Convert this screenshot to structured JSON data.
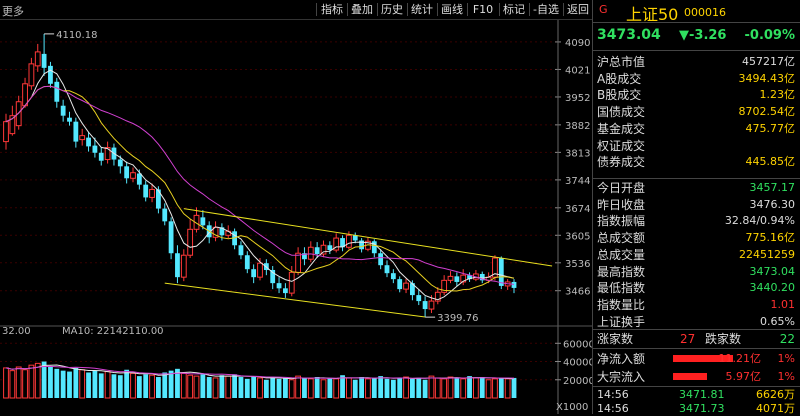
{
  "toolbar": {
    "left_label": "更多",
    "buttons": [
      "指标",
      "叠加",
      "历史",
      "统计",
      "画线",
      "F10",
      "标记",
      "-自选",
      "返回"
    ]
  },
  "chart_data": [
    {
      "type": "candlestick",
      "title": "",
      "y_ticks": [
        4090,
        4021,
        3952,
        3882,
        3813,
        3744,
        3674,
        3605,
        3536,
        3466
      ],
      "ylim": [
        3380,
        4140
      ],
      "annotations": [
        {
          "label": "4110.18",
          "value": 4110.18
        },
        {
          "label": "3399.76",
          "value": 3399.76
        }
      ],
      "candles": [
        {
          "o": 3840,
          "c": 3890,
          "h": 3910,
          "l": 3820
        },
        {
          "o": 3860,
          "c": 3905,
          "h": 3930,
          "l": 3855
        },
        {
          "o": 3880,
          "c": 3940,
          "h": 3955,
          "l": 3870
        },
        {
          "o": 3930,
          "c": 3985,
          "h": 4000,
          "l": 3925
        },
        {
          "o": 3980,
          "c": 4035,
          "h": 4050,
          "l": 3970
        },
        {
          "o": 4030,
          "c": 4065,
          "h": 4085,
          "l": 4015
        },
        {
          "o": 4060,
          "c": 4025,
          "h": 4110,
          "l": 4005
        },
        {
          "o": 4030,
          "c": 3985,
          "h": 4040,
          "l": 3975
        },
        {
          "o": 3990,
          "c": 3940,
          "h": 4000,
          "l": 3925
        },
        {
          "o": 3930,
          "c": 3905,
          "h": 3945,
          "l": 3890
        },
        {
          "o": 3900,
          "c": 3890,
          "h": 3915,
          "l": 3880
        },
        {
          "o": 3890,
          "c": 3840,
          "h": 3900,
          "l": 3825
        },
        {
          "o": 3845,
          "c": 3855,
          "h": 3872,
          "l": 3830
        },
        {
          "o": 3850,
          "c": 3828,
          "h": 3865,
          "l": 3815
        },
        {
          "o": 3830,
          "c": 3812,
          "h": 3850,
          "l": 3800
        },
        {
          "o": 3812,
          "c": 3792,
          "h": 3825,
          "l": 3780
        },
        {
          "o": 3795,
          "c": 3825,
          "h": 3840,
          "l": 3785
        },
        {
          "o": 3825,
          "c": 3795,
          "h": 3835,
          "l": 3780
        },
        {
          "o": 3795,
          "c": 3778,
          "h": 3805,
          "l": 3760
        },
        {
          "o": 3778,
          "c": 3748,
          "h": 3790,
          "l": 3735
        },
        {
          "o": 3748,
          "c": 3762,
          "h": 3775,
          "l": 3738
        },
        {
          "o": 3760,
          "c": 3732,
          "h": 3770,
          "l": 3720
        },
        {
          "o": 3732,
          "c": 3700,
          "h": 3742,
          "l": 3690
        },
        {
          "o": 3700,
          "c": 3720,
          "h": 3735,
          "l": 3688
        },
        {
          "o": 3720,
          "c": 3672,
          "h": 3728,
          "l": 3660
        },
        {
          "o": 3672,
          "c": 3640,
          "h": 3685,
          "l": 3630
        },
        {
          "o": 3640,
          "c": 3560,
          "h": 3650,
          "l": 3545
        },
        {
          "o": 3560,
          "c": 3500,
          "h": 3580,
          "l": 3485
        },
        {
          "o": 3500,
          "c": 3555,
          "h": 3570,
          "l": 3490
        },
        {
          "o": 3555,
          "c": 3620,
          "h": 3645,
          "l": 3548
        },
        {
          "o": 3620,
          "c": 3655,
          "h": 3675,
          "l": 3612
        },
        {
          "o": 3650,
          "c": 3630,
          "h": 3668,
          "l": 3620
        },
        {
          "o": 3630,
          "c": 3600,
          "h": 3640,
          "l": 3585
        },
        {
          "o": 3600,
          "c": 3625,
          "h": 3640,
          "l": 3590
        },
        {
          "o": 3625,
          "c": 3605,
          "h": 3635,
          "l": 3592
        },
        {
          "o": 3605,
          "c": 3615,
          "h": 3630,
          "l": 3598
        },
        {
          "o": 3615,
          "c": 3580,
          "h": 3622,
          "l": 3570
        },
        {
          "o": 3580,
          "c": 3555,
          "h": 3590,
          "l": 3545
        },
        {
          "o": 3555,
          "c": 3520,
          "h": 3565,
          "l": 3510
        },
        {
          "o": 3520,
          "c": 3500,
          "h": 3532,
          "l": 3485
        },
        {
          "o": 3500,
          "c": 3535,
          "h": 3548,
          "l": 3492
        },
        {
          "o": 3535,
          "c": 3518,
          "h": 3545,
          "l": 3505
        },
        {
          "o": 3518,
          "c": 3485,
          "h": 3528,
          "l": 3470
        },
        {
          "o": 3485,
          "c": 3472,
          "h": 3500,
          "l": 3460
        },
        {
          "o": 3472,
          "c": 3460,
          "h": 3485,
          "l": 3448
        },
        {
          "o": 3460,
          "c": 3512,
          "h": 3528,
          "l": 3452
        },
        {
          "o": 3512,
          "c": 3560,
          "h": 3575,
          "l": 3505
        },
        {
          "o": 3560,
          "c": 3545,
          "h": 3575,
          "l": 3530
        },
        {
          "o": 3545,
          "c": 3575,
          "h": 3590,
          "l": 3538
        },
        {
          "o": 3575,
          "c": 3558,
          "h": 3588,
          "l": 3548
        },
        {
          "o": 3558,
          "c": 3580,
          "h": 3592,
          "l": 3550
        },
        {
          "o": 3580,
          "c": 3568,
          "h": 3590,
          "l": 3558
        },
        {
          "o": 3568,
          "c": 3598,
          "h": 3610,
          "l": 3562
        },
        {
          "o": 3598,
          "c": 3575,
          "h": 3605,
          "l": 3565
        },
        {
          "o": 3575,
          "c": 3605,
          "h": 3615,
          "l": 3570
        },
        {
          "o": 3605,
          "c": 3592,
          "h": 3612,
          "l": 3585
        },
        {
          "o": 3592,
          "c": 3570,
          "h": 3598,
          "l": 3562
        },
        {
          "o": 3570,
          "c": 3590,
          "h": 3600,
          "l": 3565
        },
        {
          "o": 3590,
          "c": 3560,
          "h": 3595,
          "l": 3550
        },
        {
          "o": 3560,
          "c": 3530,
          "h": 3570,
          "l": 3520
        },
        {
          "o": 3530,
          "c": 3510,
          "h": 3542,
          "l": 3500
        },
        {
          "o": 3510,
          "c": 3495,
          "h": 3520,
          "l": 3485
        },
        {
          "o": 3495,
          "c": 3470,
          "h": 3502,
          "l": 3462
        },
        {
          "o": 3470,
          "c": 3485,
          "h": 3496,
          "l": 3460
        },
        {
          "o": 3485,
          "c": 3455,
          "h": 3492,
          "l": 3442
        },
        {
          "o": 3455,
          "c": 3440,
          "h": 3470,
          "l": 3430
        },
        {
          "o": 3440,
          "c": 3420,
          "h": 3452,
          "l": 3400
        },
        {
          "o": 3420,
          "c": 3440,
          "h": 3455,
          "l": 3410
        },
        {
          "o": 3440,
          "c": 3462,
          "h": 3475,
          "l": 3432
        },
        {
          "o": 3462,
          "c": 3492,
          "h": 3505,
          "l": 3455
        },
        {
          "o": 3492,
          "c": 3502,
          "h": 3515,
          "l": 3485
        },
        {
          "o": 3502,
          "c": 3488,
          "h": 3512,
          "l": 3478
        },
        {
          "o": 3488,
          "c": 3505,
          "h": 3520,
          "l": 3480
        },
        {
          "o": 3505,
          "c": 3495,
          "h": 3512,
          "l": 3488
        },
        {
          "o": 3495,
          "c": 3508,
          "h": 3518,
          "l": 3490
        },
        {
          "o": 3508,
          "c": 3492,
          "h": 3514,
          "l": 3485
        },
        {
          "o": 3492,
          "c": 3500,
          "h": 3512,
          "l": 3485
        },
        {
          "o": 3500,
          "c": 3548,
          "h": 3555,
          "l": 3492
        },
        {
          "o": 3548,
          "c": 3478,
          "h": 3552,
          "l": 3470
        },
        {
          "o": 3478,
          "c": 3488,
          "h": 3495,
          "l": 3468
        },
        {
          "o": 3488,
          "c": 3473,
          "h": 3495,
          "l": 3460
        }
      ]
    },
    {
      "type": "bar",
      "title": "",
      "header_left": "32.00",
      "header_ma10": "MA10: 22142110.00",
      "y_ticks": [
        60000,
        40000,
        20000
      ],
      "unit_label": "X1000",
      "ylim": [
        0,
        68000
      ],
      "values": [
        33000,
        30000,
        34000,
        31000,
        36000,
        38000,
        40000,
        35000,
        32000,
        30000,
        29000,
        33000,
        31000,
        28000,
        30000,
        27000,
        29000,
        26000,
        25000,
        31000,
        27000,
        24000,
        26000,
        25000,
        23000,
        28000,
        30000,
        32000,
        27000,
        25000,
        24000,
        26000,
        23000,
        22000,
        25000,
        24000,
        26000,
        23000,
        21000,
        24000,
        22000,
        20000,
        23000,
        21000,
        22000,
        20000,
        24000,
        22000,
        21000,
        23000,
        20000,
        22000,
        21000,
        25000,
        22000,
        20000,
        23000,
        21000,
        22000,
        24000,
        21000,
        20000,
        22000,
        23000,
        21000,
        22000,
        20000,
        24000,
        22000,
        21000,
        23000,
        22000,
        21000,
        24000,
        22000,
        23000,
        20000,
        21000,
        22000,
        21000,
        22000
      ]
    }
  ],
  "panel": {
    "badge": "G",
    "name": "上证50",
    "code": "000016",
    "price": "3473.04",
    "change": "▼-3.26",
    "change_pct": "-0.09%",
    "rows1": [
      {
        "label": "沪总市值",
        "value": "457217亿",
        "color": "#dddddd"
      },
      {
        "label": "A股成交",
        "value": "3494.43亿",
        "color": "#ffd400"
      },
      {
        "label": "B股成交",
        "value": "1.23亿",
        "color": "#ffd400"
      },
      {
        "label": "国债成交",
        "value": "8702.54亿",
        "color": "#ffd400"
      },
      {
        "label": "基金成交",
        "value": "475.77亿",
        "color": "#ffd400"
      },
      {
        "label": "权证成交",
        "value": "",
        "color": "#ffd400"
      },
      {
        "label": "债券成交",
        "value": "445.85亿",
        "color": "#ffd400"
      }
    ],
    "rows2": [
      {
        "label": "今日开盘",
        "value": "3457.17",
        "color": "#30e060"
      },
      {
        "label": "昨日收盘",
        "value": "3476.30",
        "color": "#dddddd"
      },
      {
        "label": "指数振幅",
        "value": "32.84/0.94%",
        "color": "#dddddd"
      },
      {
        "label": "总成交额",
        "value": "775.16亿",
        "color": "#ffd400"
      },
      {
        "label": "总成交量",
        "value": "22451259",
        "color": "#ffd400"
      },
      {
        "label": "最高指数",
        "value": "3473.04",
        "color": "#30e060"
      },
      {
        "label": "最低指数",
        "value": "3440.20",
        "color": "#30e060"
      },
      {
        "label": "指数量比",
        "value": "1.01",
        "color": "#ff3030"
      },
      {
        "label": "上证换手",
        "value": "0.65%",
        "color": "#dddddd"
      }
    ],
    "updown": {
      "up_label": "涨家数",
      "up_value": "27",
      "down_label": "跌家数",
      "down_value": "22"
    },
    "flows": [
      {
        "label": "净流入额",
        "value": "11.21亿",
        "pct": "1%",
        "bar": 0.88
      },
      {
        "label": "大宗流入",
        "value": "5.97亿",
        "pct": "1%",
        "bar": 0.5
      }
    ],
    "ticks": [
      {
        "time": "14:56",
        "price": "3471.81",
        "vol": "6626万"
      },
      {
        "time": "14:56",
        "price": "3471.73",
        "vol": "4071万"
      }
    ]
  }
}
